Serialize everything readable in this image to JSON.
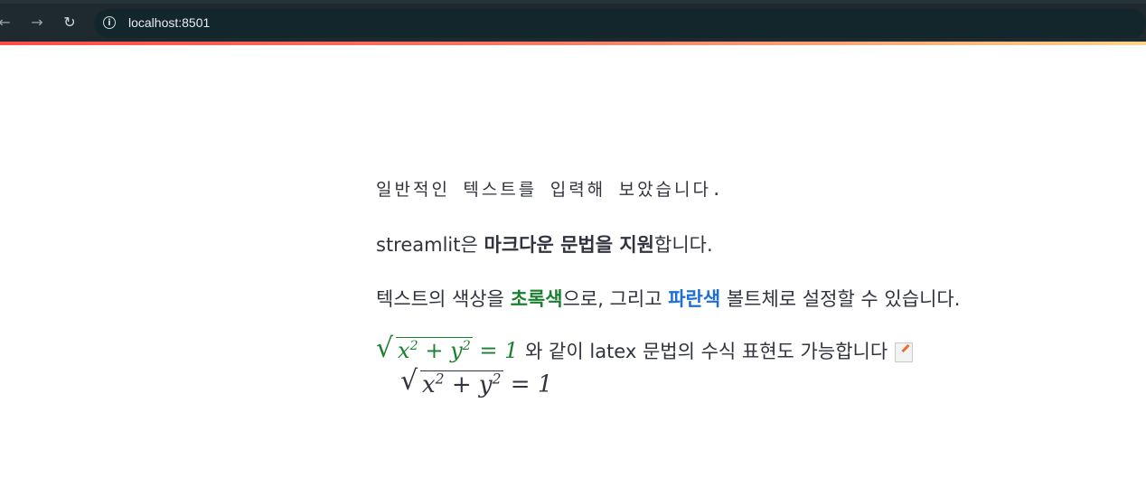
{
  "browser": {
    "url": "localhost:8501",
    "back_icon": "←",
    "forward_icon": "→",
    "reload_icon": "↻",
    "info_icon": "i"
  },
  "content": {
    "line1": "일반적인 텍스트를 입력해 보았습니다.",
    "line2": {
      "prefix": "streamlit은 ",
      "bold": "마크다운 문법을 지원",
      "suffix": "합니다."
    },
    "line3": {
      "prefix": "텍스트의 색상을 ",
      "green_bold": "초록색",
      "middle": "으로, 그리고 ",
      "blue_bold": "파란색",
      "suffix": " 볼트체로 설정할 수 있습니다."
    },
    "line4": {
      "inline_formula": "√(x² + y²) = 1",
      "text": " 와 같이 latex 문법의 수식 표현도 가능합니다",
      "emoji": "memo-icon"
    },
    "block_formula": "√(x² + y²) = 1"
  },
  "colors": {
    "text": "#31333f",
    "green": "#1a7f2e",
    "blue": "#1c6fd6",
    "browser_bg": "#1f2a2e"
  }
}
